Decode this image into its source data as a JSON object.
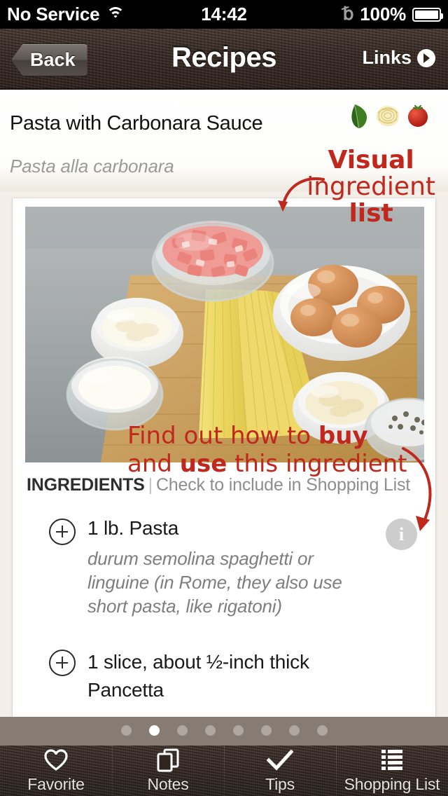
{
  "status_bar": {
    "carrier": "No Service",
    "wifi_icon": "wifi-icon",
    "time": "14:42",
    "bluetooth_icon": "bluetooth-icon",
    "battery_percent": "100%",
    "battery_icon": "battery-full-icon"
  },
  "nav_bar": {
    "back_label": "Back",
    "title": "Recipes",
    "links_label": "Links",
    "links_icon": "circle-play-icon"
  },
  "recipe": {
    "title": "Pasta with Carbonara Sauce",
    "subtitle": "Pasta alla carbonara",
    "visual_icons": [
      "basil-leaf-icon",
      "pasta-nest-icon",
      "tomato-icon"
    ],
    "photo_alt": "Carbonara ingredients on a cutting board: diced pancetta, cheese, cream, spaghetti, eggs, grated parmesan"
  },
  "ingredients_section": {
    "heading": "INGREDIENTS",
    "divider": "|",
    "hint": "Check to include in Shopping List",
    "items": [
      {
        "add_icon": "plus-circle-icon",
        "name": "1 lb. Pasta",
        "description": "durum semolina spaghetti or linguine (in Rome, they also use short pasta, like rigatoni)",
        "info_icon": "info-icon",
        "info_label": "i"
      },
      {
        "add_icon": "plus-circle-icon",
        "name": "1 slice, about ½-inch thick Pancetta",
        "description": "",
        "info_icon": null
      }
    ]
  },
  "annotations": [
    {
      "id": "annotation-visual-ingredient-list",
      "line1": "Visual",
      "line2": "ingredient",
      "line3": "list"
    },
    {
      "id": "annotation-buy-and-use",
      "part1": "Find out how to ",
      "bold1": "buy",
      "part2": "and ",
      "bold2": "use",
      "part3": " this ingredient"
    }
  ],
  "page_indicator": {
    "total": 8,
    "active_index": 1
  },
  "tab_bar": {
    "tabs": [
      {
        "icon": "heart-icon",
        "label": "Favorite"
      },
      {
        "icon": "notes-pages-icon",
        "label": "Notes"
      },
      {
        "icon": "checkmark-icon",
        "label": "Tips"
      },
      {
        "icon": "list-lines-icon",
        "label": "Shopping List"
      }
    ]
  },
  "colors": {
    "annotation_red": "#c0271d",
    "wood_dark": "#3a2c26",
    "page_bg": "#f3efe8",
    "dotbar_bg": "#867c74",
    "info_gray": "#cdcdcd"
  }
}
